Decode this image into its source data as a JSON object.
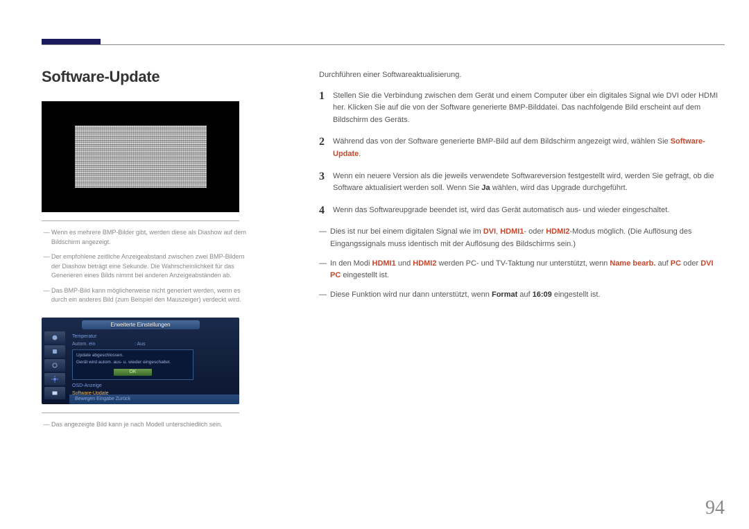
{
  "page_number": "94",
  "title": "Software-Update",
  "left_notes": [
    "Wenn es mehrere BMP-Bilder gibt, werden diese als Diashow auf dem Bildschirm angezeigt.",
    "Der empfohlene zeitliche Anzeigeabstand zwischen zwei BMP-Bildern der Diashow beträgt eine Sekunde. Die Wahrscheinlichkeit für das Generieren eines Bilds nimmt bei anderen Anzeigeabständen ab.",
    "Das BMP-Bild kann möglicherweise nicht generiert werden, wenn es durch ein anderes Bild (zum Beispiel den Mauszeiger) verdeckt wird."
  ],
  "osd": {
    "title": "Erweiterte Einstellungen",
    "rows": [
      {
        "k": "Temperatur",
        "v": ""
      },
      {
        "k": "Autom. ein",
        "v": ": Aus"
      }
    ],
    "dialog_line1": "Update abgeschlossen.",
    "dialog_line2": "Gerät wird autom. aus- u. wieder eingeschaltet.",
    "ok": "OK",
    "after1": "OSD-Anzeige",
    "after2": "Software-Update",
    "footer": "Bewegen     Eingabe     Zurück"
  },
  "model_note": "Das angezeigte Bild kann je nach Modell unterschiedlich sein.",
  "intro": "Durchführen einer Softwareaktualisierung.",
  "steps": [
    {
      "num": "1",
      "parts": [
        {
          "t": "Stellen Sie die Verbindung zwischen dem Gerät und einem Computer über ein digitales Signal wie DVI oder HDMI her. Klicken Sie auf die von der Software generierte BMP-Bilddatei. Das nachfolgende Bild erscheint auf dem Bildschirm des Geräts."
        }
      ]
    },
    {
      "num": "2",
      "parts": [
        {
          "t": "Während das von der Software generierte BMP-Bild auf dem Bildschirm angezeigt wird, wählen Sie "
        },
        {
          "t": "Software-Update",
          "red": true
        },
        {
          "t": "."
        }
      ]
    },
    {
      "num": "3",
      "parts": [
        {
          "t": "Wenn ein neuere Version als die jeweils verwendete Softwareversion festgestellt wird, werden Sie gefragt, ob die Software aktualisiert werden soll. Wenn Sie "
        },
        {
          "t": "Ja",
          "bold": true
        },
        {
          "t": " wählen, wird das Upgrade durchgeführt."
        }
      ]
    },
    {
      "num": "4",
      "parts": [
        {
          "t": "Wenn das Softwareupgrade beendet ist, wird das Gerät automatisch aus- und wieder eingeschaltet."
        }
      ]
    }
  ],
  "right_notes": [
    {
      "parts": [
        {
          "t": "Dies ist nur bei einem digitalen Signal wie im "
        },
        {
          "t": "DVI",
          "red": true
        },
        {
          "t": ", "
        },
        {
          "t": "HDMI1",
          "red": true
        },
        {
          "t": "- oder "
        },
        {
          "t": "HDMI2",
          "red": true
        },
        {
          "t": "-Modus möglich. (Die Auflösung des Eingangssignals muss identisch mit der Auflösung des Bildschirms sein.)"
        }
      ]
    },
    {
      "parts": [
        {
          "t": "In den Modi "
        },
        {
          "t": "HDMI1",
          "red": true
        },
        {
          "t": " und "
        },
        {
          "t": "HDMI2",
          "red": true
        },
        {
          "t": " werden PC- und TV-Taktung nur unterstützt, wenn "
        },
        {
          "t": "Name bearb.",
          "red": true
        },
        {
          "t": " auf "
        },
        {
          "t": "PC",
          "red": true
        },
        {
          "t": " oder "
        },
        {
          "t": "DVI PC",
          "red": true
        },
        {
          "t": " eingestellt ist."
        }
      ]
    },
    {
      "parts": [
        {
          "t": "Diese Funktion wird nur dann unterstützt, wenn "
        },
        {
          "t": "Format",
          "bold": true
        },
        {
          "t": " auf "
        },
        {
          "t": "16:09",
          "bold": true
        },
        {
          "t": " eingestellt ist."
        }
      ]
    }
  ]
}
